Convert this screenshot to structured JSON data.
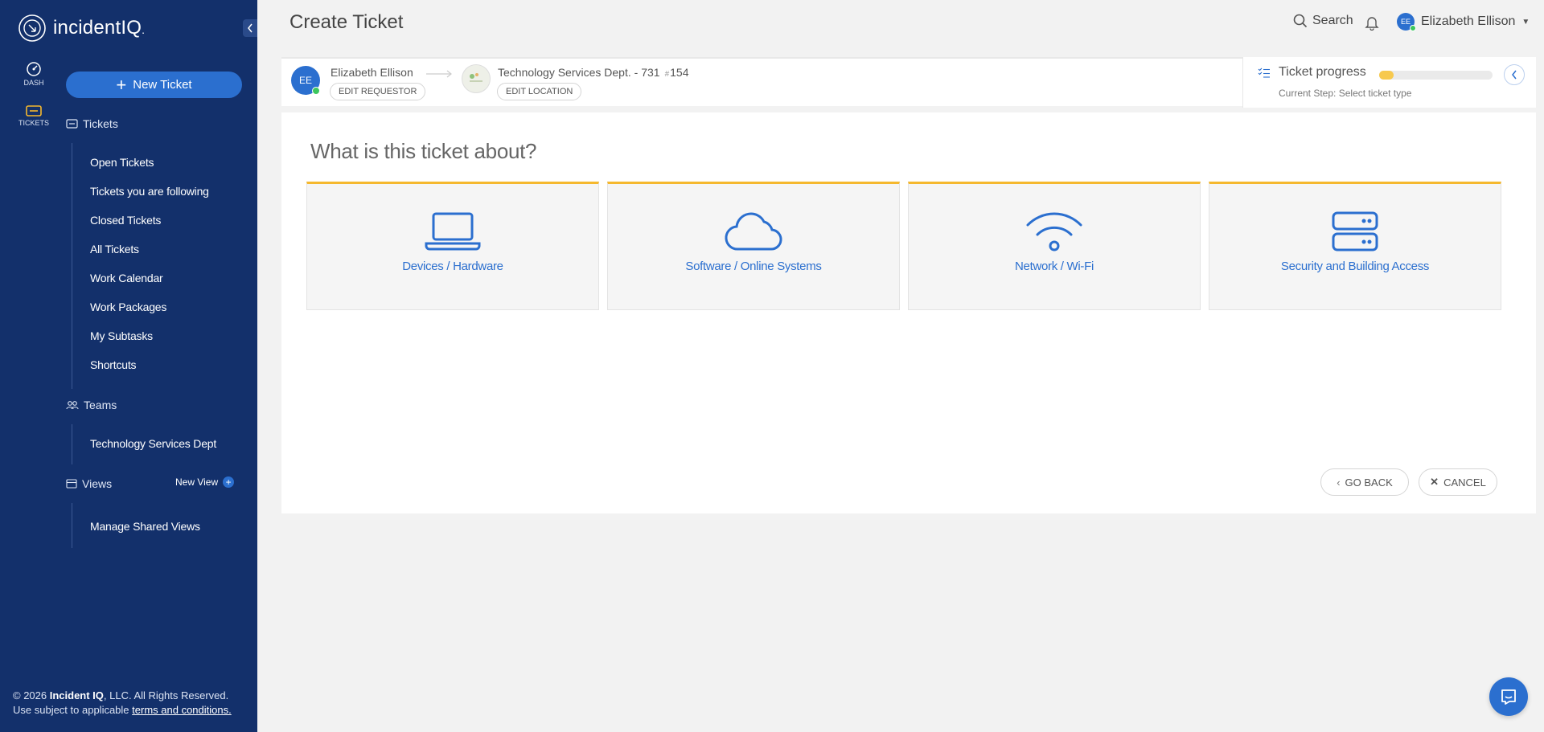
{
  "app": {
    "brand": "incidentIQ",
    "brand_suffix": "."
  },
  "sidebar": {
    "rail": [
      {
        "label": "DASH",
        "icon": "dashboard-icon"
      },
      {
        "label": "TICKETS",
        "icon": "ticket-icon"
      }
    ],
    "new_ticket_label": "New Ticket",
    "tickets_section": {
      "title": "Tickets",
      "items": [
        "Open Tickets",
        "Tickets you are following",
        "Closed Tickets",
        "All Tickets",
        "Work Calendar",
        "Work Packages",
        "My Subtasks",
        "Shortcuts"
      ]
    },
    "teams_section": {
      "title": "Teams",
      "items": [
        "Technology Services Dept"
      ]
    },
    "views_section": {
      "title": "Views",
      "new_view_label": "New View",
      "items": [
        "Manage Shared Views"
      ]
    },
    "footer": {
      "copyright_prefix": "© 2026 ",
      "company": "Incident IQ",
      "copyright_suffix": ", LLC. All Rights Reserved.",
      "terms_prefix": "Use subject to applicable ",
      "terms_link": "terms and conditions."
    }
  },
  "header": {
    "page_title": "Create Ticket",
    "search_label": "Search",
    "user_initials": "EE",
    "user_name": "Elizabeth Ellison"
  },
  "requestor": {
    "initials": "EE",
    "name": "Elizabeth Ellison",
    "edit_label": "EDIT REQUESTOR",
    "location_name": "Technology Services Dept. - 731",
    "location_number": "154",
    "edit_location_label": "EDIT LOCATION"
  },
  "progress": {
    "title": "Ticket progress",
    "current_step_label": "Current Step:",
    "current_step": "Select ticket type",
    "fraction": 0.13
  },
  "main": {
    "question": "What is this ticket about?",
    "categories": [
      {
        "label": "Devices / Hardware",
        "icon": "laptop-icon"
      },
      {
        "label": "Software / Online Systems",
        "icon": "cloud-icon"
      },
      {
        "label": "Network / Wi-Fi",
        "icon": "wifi-icon"
      },
      {
        "label": "Security and Building Access",
        "icon": "server-icon"
      }
    ],
    "go_back_label": "GO BACK",
    "cancel_label": "CANCEL"
  },
  "colors": {
    "sidebar_bg": "#13306b",
    "accent": "#2b6fcf",
    "tile_border_top": "#f5b82e",
    "progress_fill": "#f7c94e",
    "online": "#3cc65e"
  }
}
